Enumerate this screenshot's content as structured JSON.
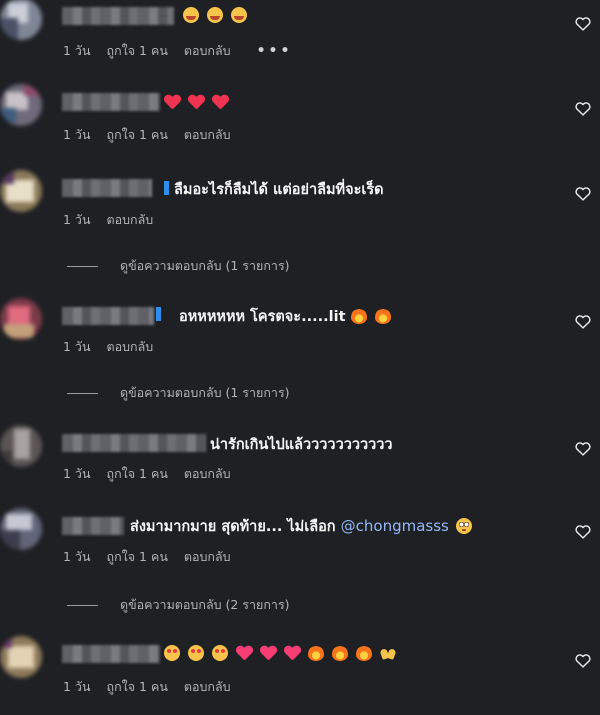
{
  "comments": [
    {
      "id": "c1",
      "text": "",
      "emojis": [
        "face-heart-eyes-hug",
        "face-heart-eyes-hug",
        "face-heart-eyes-hug"
      ],
      "meta": [
        "1 วัน",
        "ถูกใจ 1 คน",
        "ตอบกลับ"
      ],
      "more": "•••",
      "replies": ""
    },
    {
      "id": "c2",
      "text": "",
      "emojis": [
        "red-heart",
        "red-heart",
        "red-heart"
      ],
      "meta": [
        "1 วัน",
        "ถูกใจ 1 คน",
        "ตอบกลับ"
      ],
      "replies": ""
    },
    {
      "id": "c3",
      "text": "ลืมอะไรก็ลืมได้ แต่อย่าลืมที่จะเร็ด",
      "meta": [
        "1 วัน",
        "ตอบกลับ"
      ],
      "replies": "ดูข้อความตอบกลับ (1 รายการ)"
    },
    {
      "id": "c4",
      "text": "อหหหหหห โครตจะ.....lit",
      "emojis": [
        "fire",
        "fire"
      ],
      "meta": [
        "1 วัน",
        "ตอบกลับ"
      ],
      "replies": "ดูข้อความตอบกลับ (1 รายการ)"
    },
    {
      "id": "c5",
      "text": "น่ารักเกินไปแล้ววววววววววว",
      "meta": [
        "1 วัน",
        "ถูกใจ 1 คน",
        "ตอบกลับ"
      ],
      "replies": ""
    },
    {
      "id": "c6",
      "text": "ส่งมามากมาย สุดท้าย... ไม่เลือก",
      "mention": "@chongmasss",
      "emojis": [
        "flushed-face"
      ],
      "meta": [
        "1 วัน",
        "ถูกใจ 1 คน",
        "ตอบกลับ"
      ],
      "replies": "ดูข้อความตอบกลับ (2 รายการ)"
    },
    {
      "id": "c7",
      "text": "",
      "emojis": [
        "star-struck",
        "star-struck",
        "star-struck",
        "pink-heart",
        "pink-heart",
        "pink-heart",
        "fire",
        "fire",
        "fire",
        "raising-hands"
      ],
      "meta": [
        "1 วัน",
        "ถูกใจ 1 คน",
        "ตอบกลับ"
      ],
      "replies": ""
    }
  ],
  "colors": {
    "background": "#1f2024",
    "text": "#f5f5f5",
    "muted": "#b3b3b3",
    "mention": "#93b8f5",
    "heart": "#ef3350"
  },
  "icons": {
    "like": "heart-outline-icon",
    "more": "more-horizontal-icon"
  }
}
